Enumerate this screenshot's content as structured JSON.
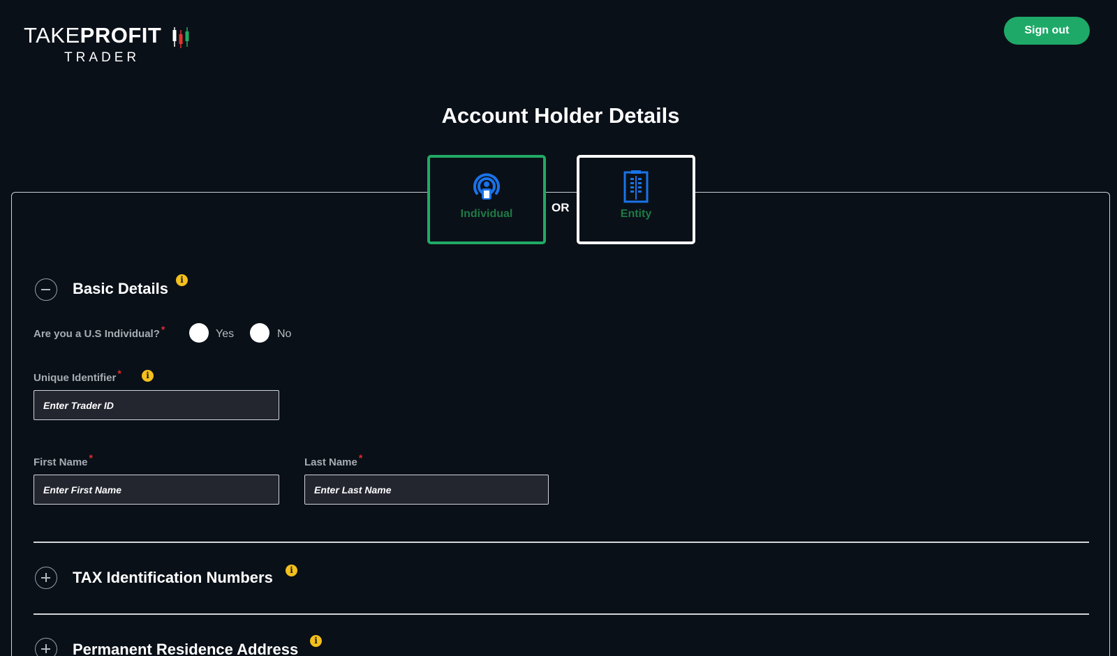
{
  "brand": {
    "logo_take": "TAKE",
    "logo_profit": "PROFIT",
    "logo_trader": "TRADER"
  },
  "header": {
    "signout_label": "Sign out"
  },
  "page": {
    "title": "Account Holder Details"
  },
  "account_type": {
    "individual_label": "Individual",
    "or_text": "OR",
    "entity_label": "Entity"
  },
  "colors": {
    "accent_green": "#1fa968",
    "background": "#0a1018",
    "info_yellow": "#f3c01c",
    "required_red": "#e32b2b",
    "icon_blue": "#1a73e8"
  },
  "icons": [
    "person-pin-icon",
    "building-icon",
    "minus-circle-icon",
    "plus-circle-icon",
    "info-icon"
  ],
  "sections": {
    "basic": {
      "title": "Basic Details"
    },
    "tax": {
      "title": "TAX Identification Numbers"
    },
    "address": {
      "title": "Permanent Residence Address"
    }
  },
  "form": {
    "us_question": "Are you a U.S Individual?",
    "yes_label": "Yes",
    "no_label": "No",
    "unique_label": "Unique Identifier",
    "unique_placeholder": "Enter Trader ID",
    "first_label": "First Name",
    "first_placeholder": "Enter First Name",
    "last_label": "Last Name",
    "last_placeholder": "Enter Last Name",
    "required_mark": "*",
    "info_glyph": "i"
  }
}
